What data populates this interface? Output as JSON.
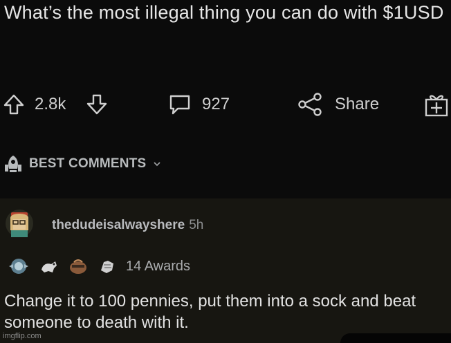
{
  "post": {
    "title": "What’s the most illegal thing you can do with $1USD"
  },
  "actions": {
    "upvote_icon": "upvote-arrow-icon",
    "score": "2.8k",
    "downvote_icon": "downvote-arrow-icon",
    "comment_icon": "comment-bubble-icon",
    "comment_count": "927",
    "share_icon": "share-icon",
    "share_label": "Share",
    "award_icon": "gift-icon"
  },
  "sort": {
    "icon": "rocket-icon",
    "label": "BEST COMMENTS",
    "chevron_icon": "chevron-down-icon"
  },
  "comment": {
    "avatar": "avatar-icon",
    "username": "thedudeisalwayshere",
    "age": "5h",
    "awards_label": "14 Awards",
    "award_icons": [
      "award-globe-icon",
      "award-animal-icon",
      "award-bag-icon",
      "award-fist-icon"
    ],
    "body": "Change it to 100 pennies, put them into a sock and beat someone to death with it."
  },
  "watermark": "imgflip.com",
  "colors": {
    "background": "#0b0b0b",
    "comment_background": "#171611",
    "text": "#e2e2e2",
    "muted": "#8d8f91"
  }
}
